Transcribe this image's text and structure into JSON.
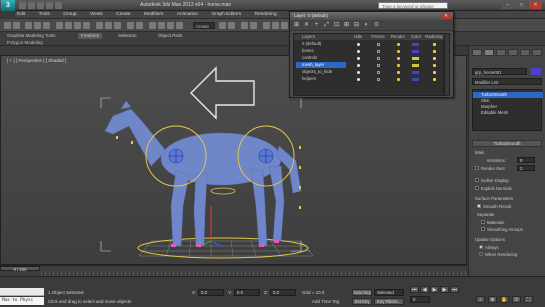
{
  "title_bar": {
    "app_logo": "3",
    "window_title": "Autodesk 3ds Max 2013 x64 - horse.max",
    "search_placeholder": "Type a keyword or phrase",
    "minimize": "–",
    "maximize": "□",
    "close": "✕"
  },
  "menu": [
    "Edit",
    "Tools",
    "Group",
    "Views",
    "Create",
    "Modifiers",
    "Animation",
    "Graph Editors",
    "Rendering",
    "Customize",
    "MAXScript",
    "Help"
  ],
  "toolbar": {
    "selection_set": "Create Selection Se"
  },
  "ribbon": {
    "tabs": [
      "Graphite Modeling Tools",
      "Freeform",
      "Selection",
      "Object Paint"
    ],
    "active_tab": 1,
    "panel_label": "Polygon Modeling"
  },
  "viewport": {
    "label": "[ + ] [ Perspective ] [ Shaded ]"
  },
  "layer_dialog": {
    "title": "Layer: 0 (default)",
    "tools": [
      "⊞",
      "✕",
      "+",
      "⤢",
      "⊡",
      "⊞",
      "⊟",
      "◐",
      "⊙"
    ],
    "columns": [
      "Layers",
      "Hide",
      "Freeze",
      "Render",
      "Color",
      "Radiosity"
    ],
    "rows": [
      {
        "name": "0 (default)",
        "color": "#4a3ed0",
        "selected": false
      },
      {
        "name": "bones",
        "color": "#4a3ed0",
        "selected": false
      },
      {
        "name": "controls",
        "color": "#d6c43c",
        "selected": false
      },
      {
        "name": "mesh_layer",
        "color": "#d6c43c",
        "selected": true
      },
      {
        "name": "objects_to_hide",
        "color": "#4a3ed0",
        "selected": false
      },
      {
        "name": "helpers",
        "color": "#4a3ed0",
        "selected": false
      }
    ]
  },
  "command_panel": {
    "object_name": "grp_horse001",
    "object_color": "#4e3fcf",
    "modifier_list": "Modifier List",
    "stack": [
      {
        "label": "TurboSmooth",
        "selected": true
      },
      {
        "label": "Skin",
        "selected": false
      },
      {
        "label": "Morpher",
        "selected": false
      },
      {
        "label": "Editable Mesh",
        "selected": false
      }
    ],
    "rollout_title": "TurboSmooth",
    "main_label": "Main",
    "iterations_label": "Iterations:",
    "iterations_value": "0",
    "render_iters_label": "Render Iters:",
    "render_iters_value": "2",
    "isoline_label": "Isoline Display",
    "explicit_normals_label": "Explicit Normals",
    "surface_params_label": "Surface Parameters",
    "smooth_result_label": "Smooth Result",
    "separate_label": "Separate",
    "materials_label": "Materials",
    "smoothing_groups_label": "Smoothing Groups",
    "update_options_label": "Update Options",
    "always_label": "Always",
    "when_rendering_label": "When Rendering"
  },
  "timeline": {
    "frame_readout": "0 / 100"
  },
  "status": {
    "maxscript_label": "Max to Physc",
    "selection_info": "1 Object Selected",
    "prompt": "Click and drag to select and move objects",
    "x_label": "X:",
    "x_value": "0.0",
    "y_label": "Y:",
    "y_value": "0.0",
    "z_label": "Z:",
    "z_value": "0.0",
    "grid_label": "Grid = 10.0",
    "add_time_tag": "Add Time Tag",
    "auto_key": "Auto Key",
    "auto_key_mode": "Selected",
    "set_key": "Set Key",
    "key_filters": "Key Filters...",
    "frame": "0"
  }
}
